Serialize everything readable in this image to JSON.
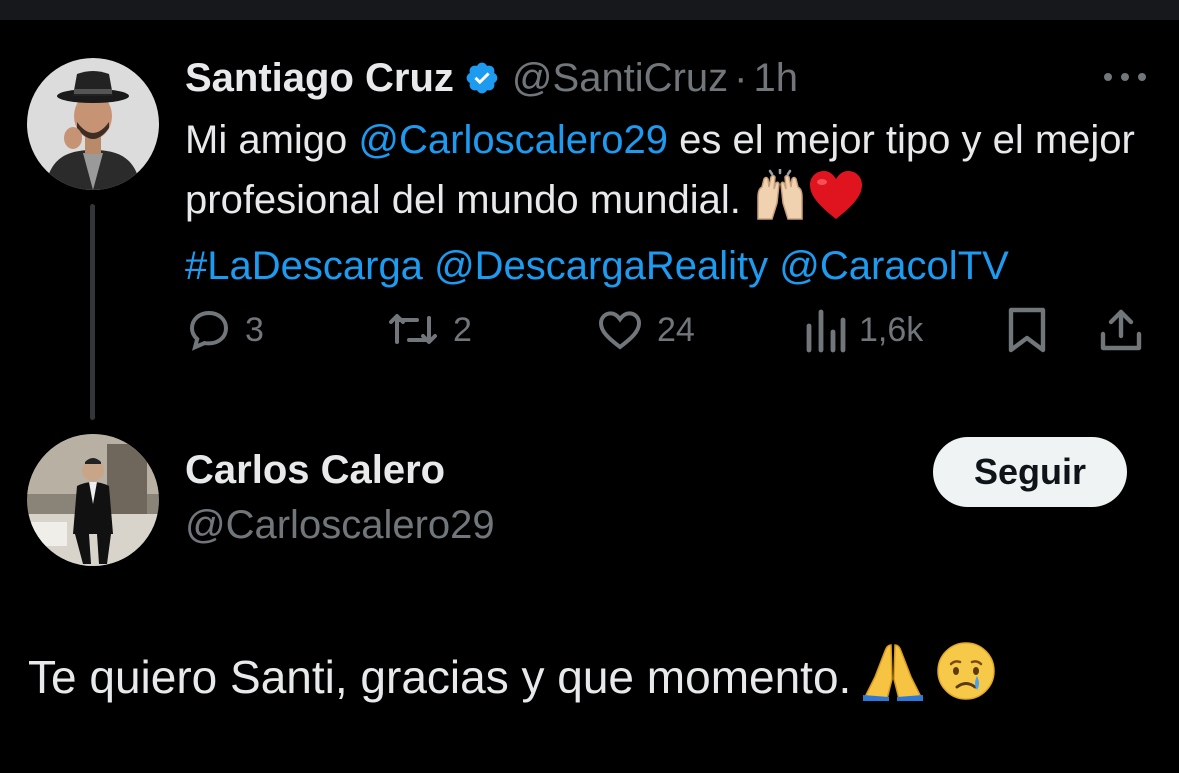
{
  "colors": {
    "background": "#000000",
    "text": "#e7e9ea",
    "muted": "#71767b",
    "link": "#1d9bf0",
    "thread_line": "#333639",
    "button_bg": "#eff3f4"
  },
  "tweet": {
    "author_name": "Santiago Cruz",
    "verified_icon": "verified-badge-icon",
    "handle": "@SantiCruz",
    "separator": "·",
    "time": "1h",
    "more_icon": "more-options-icon",
    "text_part1": "Mi amigo ",
    "mention1": "@Carloscalero29",
    "text_part2": " es el mejor tipo y el mejor profesional del mundo mundial. ",
    "emoji_icons": [
      "raising-hands-icon",
      "red-heart-icon"
    ],
    "hashtag": "#LaDescarga",
    "mention2": "@DescargaReality",
    "mention3": "@CaracolTV",
    "actions": {
      "reply_count": "3",
      "retweet_count": "2",
      "like_count": "24",
      "views_count": "1,6k"
    }
  },
  "reply": {
    "author_name": "Carlos Calero",
    "handle": "@Carloscalero29",
    "follow_label": "Seguir",
    "text": "Te quiero Santi, gracias y que momento.",
    "emoji_icons": [
      "folded-hands-icon",
      "crying-face-icon"
    ]
  }
}
